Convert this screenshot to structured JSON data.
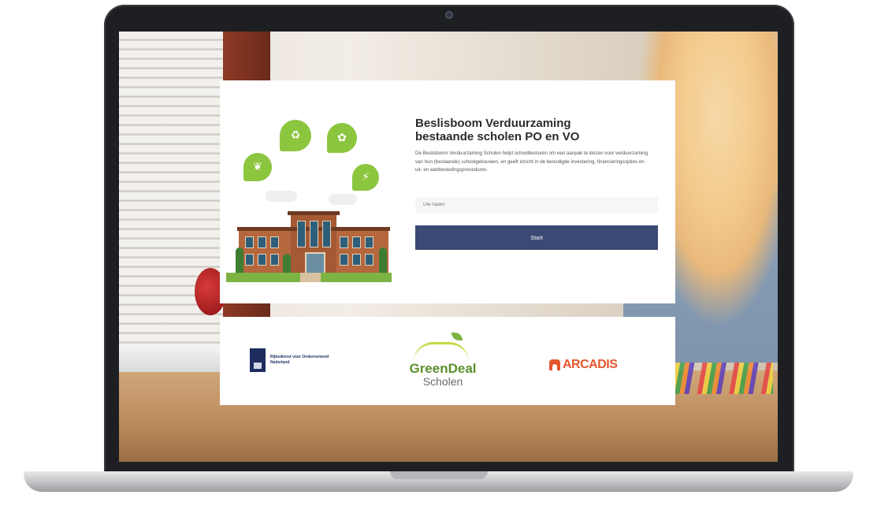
{
  "app": {
    "title_line1": "Beslisboom Verduurzaming",
    "title_line2": "bestaande scholen PO en VO",
    "description": "De Beslisboom Verduurzaming Scholen helpt schoolbesturen om een aanpak te kiezen voor verduurzaming van hun (bestaande) schoolgebouwen, en geeft inzicht in de benodigde investering, financieringsopties en uit- en aanbestedingsprocedures.",
    "name_field": {
      "placeholder": "Uw naam"
    },
    "start_button": "Start"
  },
  "logos": {
    "rijks_text": "Rijksdienst voor Ondernemend Nederland",
    "greendeal_line1": "GreenDeal",
    "greendeal_line2": "Scholen",
    "arcadis": "ARCADIS"
  },
  "icons": [
    "leaf-icon",
    "recycle-icon",
    "plant-icon",
    "energy-icon"
  ],
  "colors": {
    "primary_button": "#3a4a74",
    "accent_green": "#8cc63f",
    "arcadis_orange": "#e4572e"
  }
}
